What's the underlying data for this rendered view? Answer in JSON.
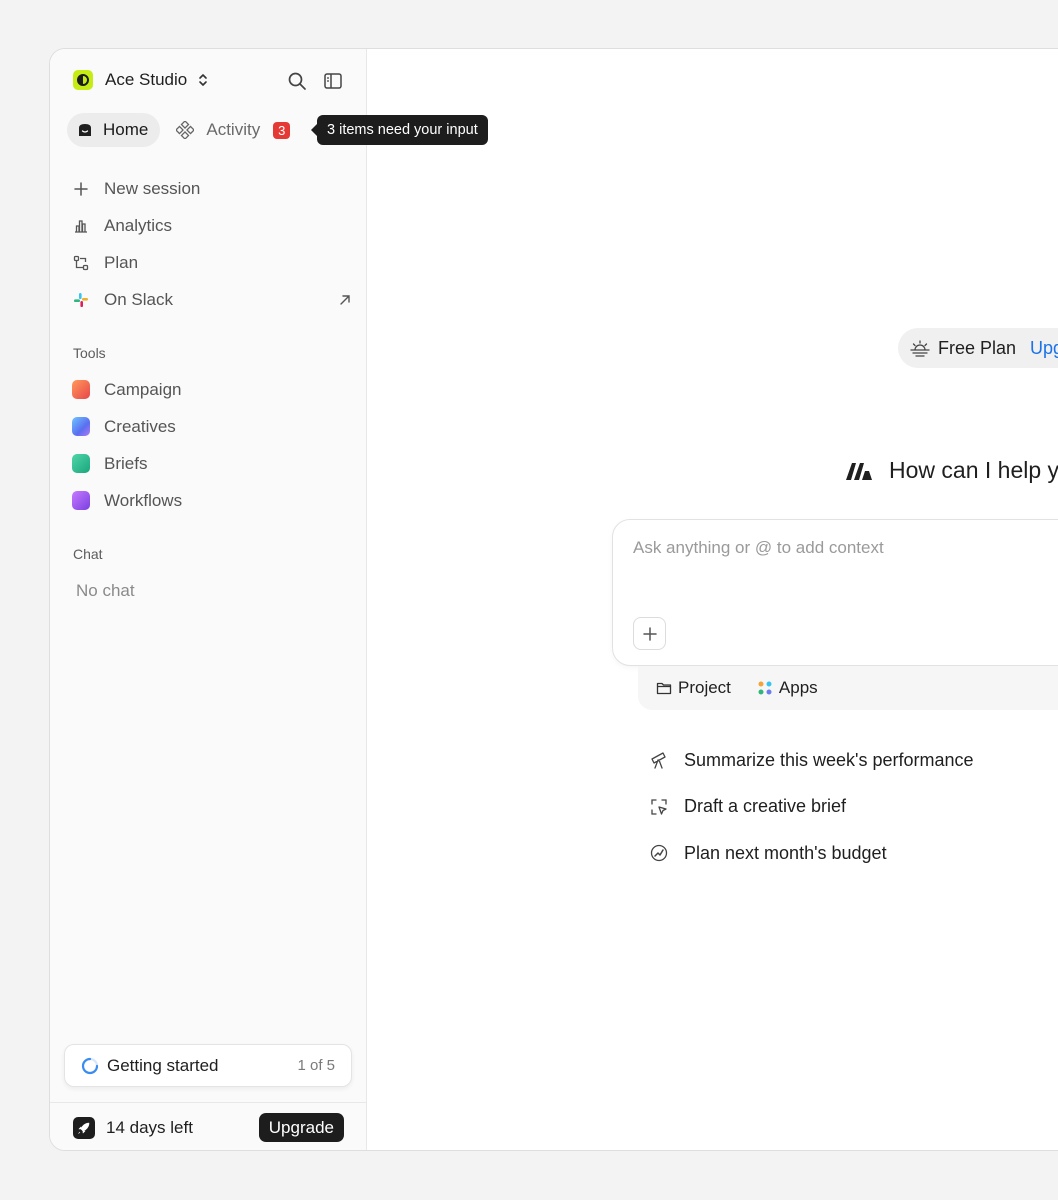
{
  "workspace": {
    "name": "Ace Studio"
  },
  "tabs": {
    "home": "Home",
    "activity": "Activity",
    "activity_badge": "3"
  },
  "tooltip": "3 items need your input",
  "menu": [
    {
      "label": "New session",
      "icon": "plus-icon"
    },
    {
      "label": "Analytics",
      "icon": "bar-chart-icon"
    },
    {
      "label": "Plan",
      "icon": "flow-icon"
    },
    {
      "label": "On Slack",
      "icon": "slack-icon"
    }
  ],
  "tools": {
    "title": "Tools",
    "items": [
      {
        "label": "Campaign",
        "icon": "campaign-icon",
        "color": "#f2674a"
      },
      {
        "label": "Creatives",
        "icon": "creatives-icon",
        "color": "#5a8dee"
      },
      {
        "label": "Briefs",
        "icon": "briefs-icon",
        "color": "#2bb38a"
      },
      {
        "label": "Workflows",
        "icon": "workflows-icon",
        "color": "#9b59e6"
      }
    ]
  },
  "chat": {
    "title": "Chat",
    "empty": "No chat"
  },
  "getting_started": {
    "label": "Getting started",
    "progress": "1 of 5"
  },
  "footer": {
    "days_left": "14 days left",
    "upgrade": "Upgrade"
  },
  "main": {
    "plan": {
      "name": "Free Plan",
      "upgrade": "Upg"
    },
    "heading": "How can I help y",
    "composer": {
      "placeholder": "Ask anything or @ to add context"
    },
    "context": {
      "project": "Project",
      "apps": "Apps"
    },
    "suggestions": [
      "Summarize this week's performance",
      "Draft a creative brief",
      "Plan next month's budget"
    ]
  }
}
